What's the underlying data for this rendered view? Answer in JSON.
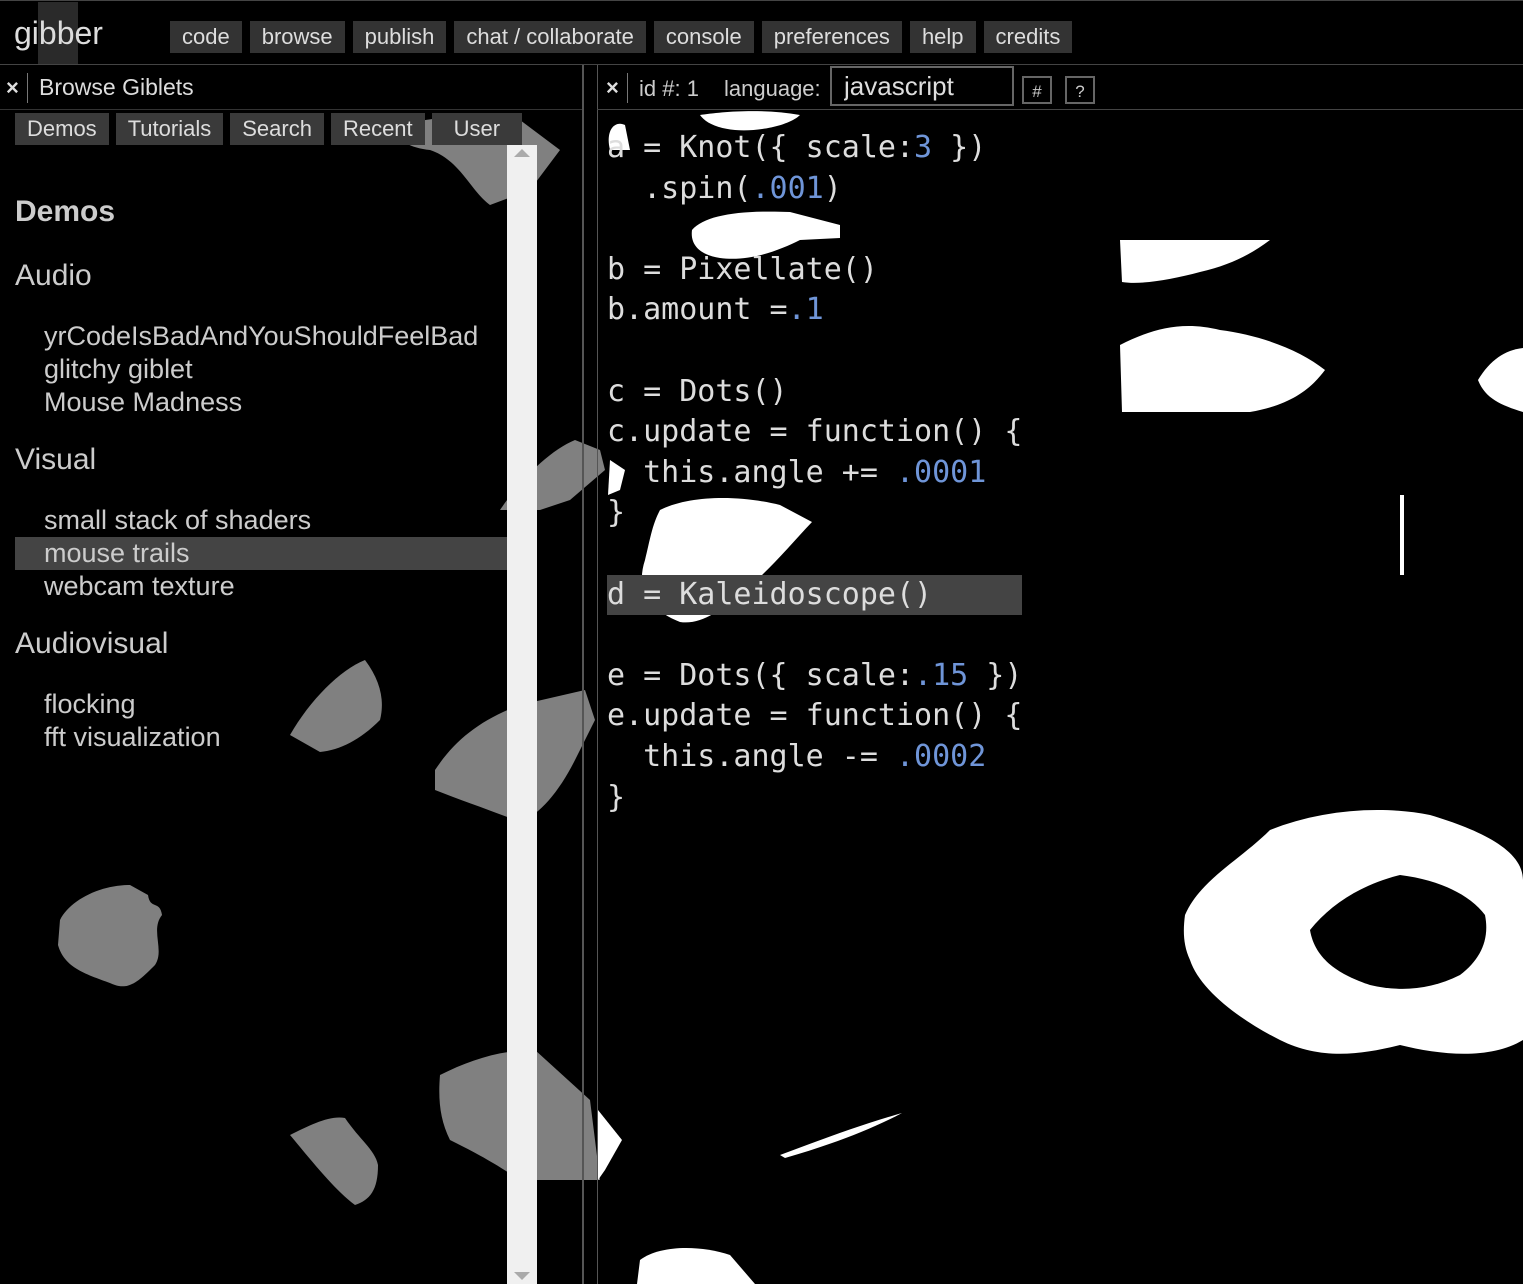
{
  "app": {
    "logo": "gibber"
  },
  "menu": [
    "code",
    "browse",
    "publish",
    "chat / collaborate",
    "console",
    "preferences",
    "help",
    "credits"
  ],
  "browse_panel": {
    "close_glyph": "×",
    "title": "Browse Giblets",
    "tabs": [
      "Demos",
      "Tutorials",
      "Search",
      "Recent",
      "User"
    ],
    "heading": "Demos",
    "categories": [
      {
        "name": "Audio",
        "items": [
          "yrCodeIsBadAndYouShouldFeelBad",
          "glitchy giblet",
          "Mouse Madness"
        ]
      },
      {
        "name": "Visual",
        "items": [
          "small stack of shaders",
          "mouse trails",
          "webcam texture"
        ],
        "selected": "mouse trails"
      },
      {
        "name": "Audiovisual",
        "items": [
          "flocking",
          "fft visualization"
        ]
      }
    ]
  },
  "editor": {
    "close_glyph": "×",
    "id_label": "id #: 1",
    "language_label": "language:",
    "language_value": "javascript",
    "hash_button": "#",
    "help_button": "?",
    "code_lines": [
      "a = Knot({ scale:3 })",
      "  .spin(.001)",
      "",
      "b = Pixellate()",
      "b.amount =.1",
      "",
      "c = Dots()",
      "c.update = function() {",
      "  this.angle += .0001",
      "}",
      "",
      "d = Kaleidoscope()",
      "",
      "e = Dots({ scale:.15 })",
      "e.update = function() {",
      "  this.angle -= .0002",
      "}"
    ],
    "highlighted_line": 11
  },
  "colors": {
    "number": "#6f95d8",
    "selection": "#444444",
    "scrollbar": "#f0f0f0"
  }
}
